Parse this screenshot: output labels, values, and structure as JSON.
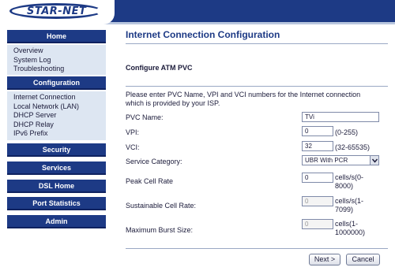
{
  "brand": {
    "name": "STAR-NET"
  },
  "sidebar": {
    "home": {
      "label": "Home",
      "links": [
        "Overview",
        "System Log",
        "Troubleshooting"
      ]
    },
    "configuration": {
      "label": "Configuration",
      "links": [
        "Internet Connection",
        "Local Network (LAN)",
        "DHCP Server",
        "DHCP Relay",
        "IPv6 Prefix"
      ]
    },
    "security": "Security",
    "services": "Services",
    "dsl_home": "DSL Home",
    "port_statistics": "Port Statistics",
    "admin": "Admin"
  },
  "main": {
    "title": "Internet Connection Configuration",
    "section": "Configure ATM PVC",
    "intro": "Please enter PVC Name, VPI and VCI numbers for the Internet connection which is provided by your ISP.",
    "fields": {
      "pvc_name": {
        "label": "PVC Name:",
        "value": "TVi"
      },
      "vpi": {
        "label": "VPI:",
        "value": "0",
        "hint": "(0-255)"
      },
      "vci": {
        "label": "VCI:",
        "value": "32",
        "hint": "(32-65535)"
      },
      "service_category": {
        "label": "Service Category:",
        "value": "UBR With PCR"
      },
      "peak_cell_rate": {
        "label": "Peak Cell Rate",
        "value": "0",
        "hint": "cells/s(0-8000)"
      },
      "sustainable_cell_rate": {
        "label": "Sustainable Cell Rate:",
        "value": "0",
        "hint": "cells/s(1-7099)"
      },
      "max_burst_size": {
        "label": "Maximum Burst Size:",
        "value": "0",
        "hint": "cells(1-1000000)"
      }
    },
    "buttons": {
      "next": "Next >",
      "cancel": "Cancel"
    }
  },
  "icons": {
    "select_arrow": "chevron-down-icon"
  },
  "colors": {
    "brand_navy": "#1d3a85",
    "sidebar_panel": "#dde6f2"
  }
}
